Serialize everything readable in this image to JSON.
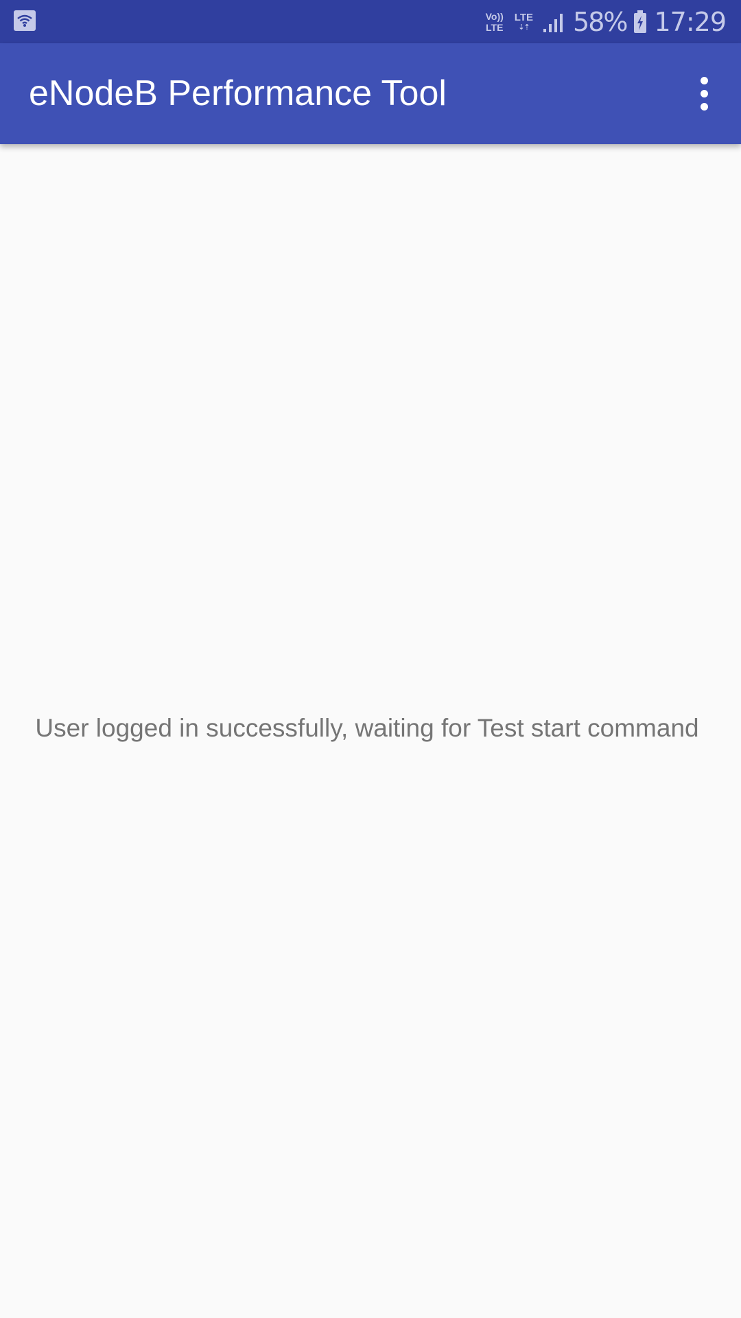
{
  "status_bar": {
    "icons": [
      "wifi-icon",
      "volte-icon",
      "lte-data-icon",
      "signal-icon",
      "battery-charging-icon"
    ],
    "volte_top": "Vo))",
    "volte_bottom": "LTE",
    "lte_label": "LTE",
    "lte_arrows": "⇣⇡",
    "battery_percent": "58%",
    "time": "17:29"
  },
  "app_bar": {
    "title": "eNodeB Performance Tool",
    "menu_icon": "more-vert-icon"
  },
  "main": {
    "message": "User logged in successfully, waiting for Test start command"
  },
  "colors": {
    "status_bar": "#303f9f",
    "app_bar": "#3f51b5",
    "background": "#fafafa",
    "message_text": "#757575"
  }
}
